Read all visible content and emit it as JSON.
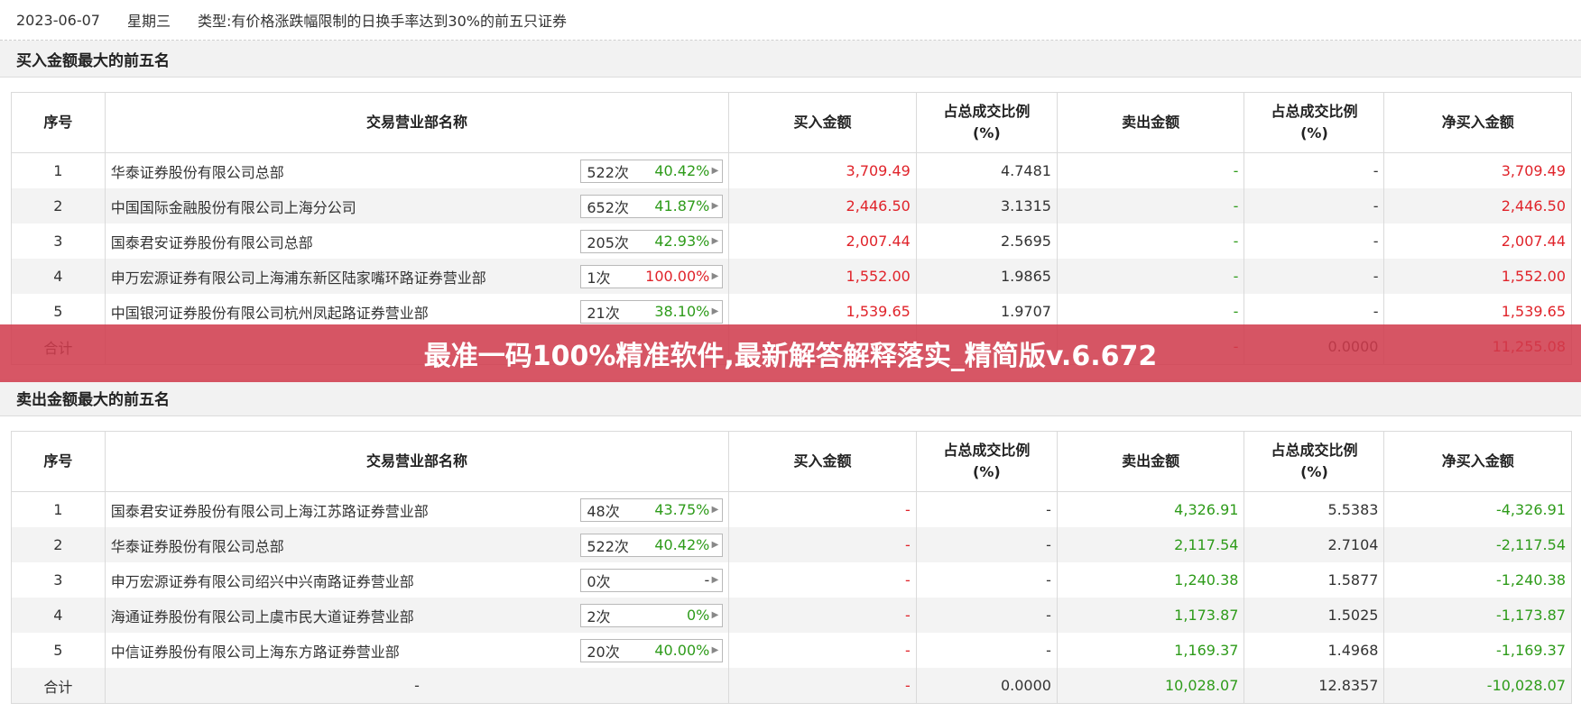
{
  "header": {
    "date": "2023-06-07",
    "weekday": "星期三",
    "type_label": "类型:有价格涨跌幅限制的日换手率达到30%的前五只证券"
  },
  "columns": {
    "idx": "序号",
    "dept": "交易营业部名称",
    "buy": "买入金额",
    "buy_pct": "占总成交比例\n(%)",
    "sell": "卖出金额",
    "sell_pct": "占总成交比例\n(%)",
    "net": "净买入金额"
  },
  "buy_section": {
    "title": "买入金额最大的前五名",
    "rows": [
      {
        "idx": "1",
        "name": "华泰证券股份有限公司总部",
        "count": "522次",
        "rate": "40.42%",
        "rate_color": "green",
        "buy": "3,709.49",
        "buy_pct": "4.7481",
        "sell": "-",
        "sell_pct": "-",
        "net": "3,709.49"
      },
      {
        "idx": "2",
        "name": "中国国际金融股份有限公司上海分公司",
        "count": "652次",
        "rate": "41.87%",
        "rate_color": "green",
        "buy": "2,446.50",
        "buy_pct": "3.1315",
        "sell": "-",
        "sell_pct": "-",
        "net": "2,446.50"
      },
      {
        "idx": "3",
        "name": "国泰君安证券股份有限公司总部",
        "count": "205次",
        "rate": "42.93%",
        "rate_color": "green",
        "buy": "2,007.44",
        "buy_pct": "2.5695",
        "sell": "-",
        "sell_pct": "-",
        "net": "2,007.44"
      },
      {
        "idx": "4",
        "name": "申万宏源证券有限公司上海浦东新区陆家嘴环路证券营业部",
        "count": "1次",
        "rate": "100.00%",
        "rate_color": "red",
        "buy": "1,552.00",
        "buy_pct": "1.9865",
        "sell": "-",
        "sell_pct": "-",
        "net": "1,552.00"
      },
      {
        "idx": "5",
        "name": "中国银河证券股份有限公司杭州凤起路证券营业部",
        "count": "21次",
        "rate": "38.10%",
        "rate_color": "green",
        "buy": "1,539.65",
        "buy_pct": "1.9707",
        "sell": "-",
        "sell_pct": "-",
        "net": "1,539.65"
      }
    ],
    "total": {
      "label": "合计",
      "dept": "",
      "buy": "",
      "buy_pct": "",
      "sell": "-",
      "sell_pct": "0.0000",
      "net": "11,255.08"
    }
  },
  "sell_section": {
    "title": "卖出金额最大的前五名",
    "rows": [
      {
        "idx": "1",
        "name": "国泰君安证券股份有限公司上海江苏路证券营业部",
        "count": "48次",
        "rate": "43.75%",
        "rate_color": "green",
        "buy": "-",
        "buy_pct": "-",
        "sell": "4,326.91",
        "sell_pct": "5.5383",
        "net": "-4,326.91"
      },
      {
        "idx": "2",
        "name": "华泰证券股份有限公司总部",
        "count": "522次",
        "rate": "40.42%",
        "rate_color": "green",
        "buy": "-",
        "buy_pct": "-",
        "sell": "2,117.54",
        "sell_pct": "2.7104",
        "net": "-2,117.54"
      },
      {
        "idx": "3",
        "name": "申万宏源证券有限公司绍兴中兴南路证券营业部",
        "count": "0次",
        "rate": "-",
        "rate_color": "gray",
        "buy": "-",
        "buy_pct": "-",
        "sell": "1,240.38",
        "sell_pct": "1.5877",
        "net": "-1,240.38"
      },
      {
        "idx": "4",
        "name": "海通证券股份有限公司上虞市民大道证券营业部",
        "count": "2次",
        "rate": "0%",
        "rate_color": "green",
        "buy": "-",
        "buy_pct": "-",
        "sell": "1,173.87",
        "sell_pct": "1.5025",
        "net": "-1,173.87"
      },
      {
        "idx": "5",
        "name": "中信证券股份有限公司上海东方路证券营业部",
        "count": "20次",
        "rate": "40.00%",
        "rate_color": "green",
        "buy": "-",
        "buy_pct": "-",
        "sell": "1,169.37",
        "sell_pct": "1.4968",
        "net": "-1,169.37"
      }
    ],
    "total": {
      "label": "合计",
      "dept": "-",
      "buy": "-",
      "buy_pct": "0.0000",
      "sell": "10,028.07",
      "sell_pct": "12.8357",
      "net": "-10,028.07"
    }
  },
  "banner": {
    "text": "最准一码100%精准软件,最新解答解释落实_精简版v.6.672"
  },
  "colors": {
    "red": "#e0232a",
    "green": "#2e9b1a",
    "banner": "#d03a4c"
  }
}
